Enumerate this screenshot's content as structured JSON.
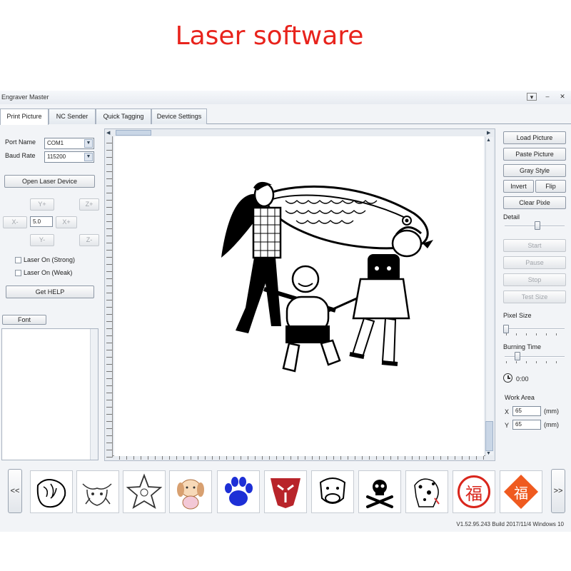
{
  "headline": "Laser software",
  "window": {
    "title": "Engraver Master",
    "controls": [
      "▾",
      "–",
      "✕"
    ]
  },
  "tabs": [
    {
      "label": "Print Picture"
    },
    {
      "label": "NC Sender"
    },
    {
      "label": "Quick Tagging"
    },
    {
      "label": "Device Settings"
    }
  ],
  "left": {
    "port_label": "Port Name",
    "port_value": "COM1",
    "baud_label": "Baud Rate",
    "baud_value": "115200",
    "open_device": "Open Laser Device",
    "y_plus": "Y+",
    "z_plus": "Z+",
    "x_minus": "X-",
    "step_value": "5.0",
    "x_plus": "X+",
    "y_minus": "Y-",
    "z_minus": "Z-",
    "laser_strong": "Laser On (Strong)",
    "laser_weak": "Laser On (Weak)",
    "help": "Get HELP",
    "font": "Font"
  },
  "right": {
    "load_picture": "Load Picture",
    "paste_picture": "Paste Picture",
    "gray_style": "Gray Style",
    "invert": "Invert",
    "flip": "Flip",
    "clear_pixle": "Clear Pixle",
    "detail_label": "Detail",
    "detail_level": 0.55,
    "start": "Start",
    "pause": "Pause",
    "stop": "Stop",
    "test_size": "Test Size",
    "pixel_size_label": "Pixel Size",
    "pixel_size_level": 0.0,
    "burning_time_label": "Burning Time",
    "burning_time_level": 0.2,
    "timer": "0:00",
    "work_area_label": "Work Area",
    "x_label": "X",
    "x_value": "65",
    "y_label": "Y",
    "y_value": "65",
    "unit": "(mm)"
  },
  "gallery": {
    "prev": "<<",
    "next": ">>",
    "items": [
      "hand-drawing",
      "bull-drawing",
      "star-drawing",
      "puppy-drawing",
      "paw-print",
      "transformer-logo",
      "cow-drawing",
      "skull-crossbones",
      "dalmatian-drawing",
      "fu-seal",
      "fu-diamond"
    ],
    "fu_char": "福"
  },
  "version": "V1.52.95.243 Build 2017/11/4 Windows 10",
  "colors": {
    "headline": "#e8231c",
    "paw": "#1d2fd6",
    "transformer": "#b8242a",
    "fu_red": "#d9261c",
    "fu_orange": "#ef5a1f"
  }
}
